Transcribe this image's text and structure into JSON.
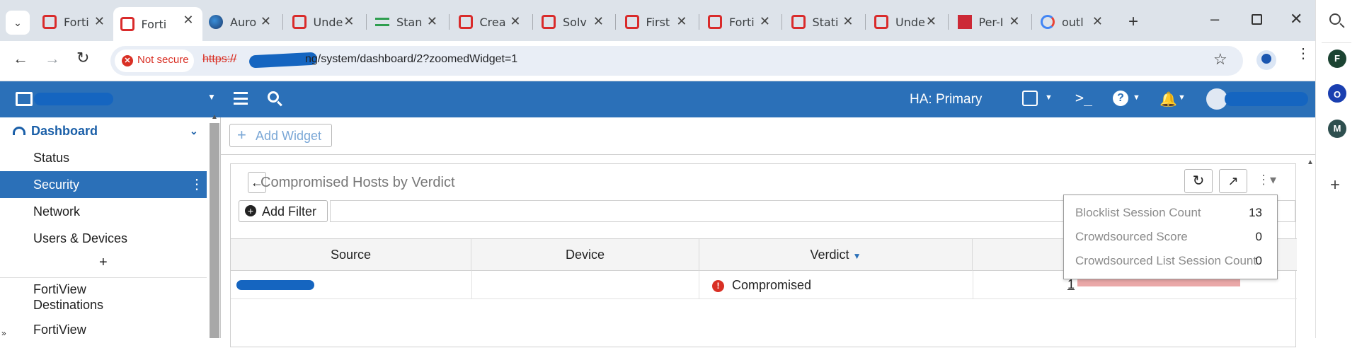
{
  "browser": {
    "tabs": [
      {
        "title": "Forti",
        "icon": "fortinet-icon"
      },
      {
        "title": "Forti",
        "icon": "fortinet-icon",
        "active": true
      },
      {
        "title": "Auro",
        "icon": "globe-icon"
      },
      {
        "title": "Unde",
        "icon": "fortinet-icon"
      },
      {
        "title": "Stan",
        "icon": "green-link-icon"
      },
      {
        "title": "Crea",
        "icon": "fortinet-icon"
      },
      {
        "title": "Solv",
        "icon": "fortinet-icon"
      },
      {
        "title": "First",
        "icon": "fortinet-icon"
      },
      {
        "title": "Forti",
        "icon": "fortinet-icon"
      },
      {
        "title": "Stati",
        "icon": "fortinet-icon"
      },
      {
        "title": "Unde",
        "icon": "fortinet-icon"
      },
      {
        "title": "Per-I",
        "icon": "zotero-icon"
      },
      {
        "title": "outl",
        "icon": "google-icon"
      }
    ],
    "not_secure_label": "Not secure",
    "url_scheme": "https://",
    "url_path": "ng/system/dashboard/2?zoomedWidget=1",
    "side_avatars": [
      "F",
      "O",
      "M"
    ]
  },
  "fg_header": {
    "ha_status": "HA: Primary"
  },
  "nav": {
    "section": "Dashboard",
    "items": [
      "Status",
      "Security",
      "Network",
      "Users & Devices"
    ],
    "add_symbol": "+",
    "fortiview_destinations": "FortiView Destinations",
    "fortiview_more": "FortiView"
  },
  "main": {
    "add_widget": "Add Widget",
    "widget_title": "Compromised Hosts by Verdict",
    "add_filter": "Add Filter",
    "columns": [
      "Source",
      "Device",
      "Verdict",
      ""
    ],
    "rows": [
      {
        "source": "",
        "device": "",
        "verdict": "Compromised",
        "count": "1"
      }
    ]
  },
  "tooltip": {
    "rows": [
      {
        "label": "Blocklist Session Count",
        "value": "13"
      },
      {
        "label": "Crowdsourced Score",
        "value": "0"
      },
      {
        "label": "Crowdsourced List Session Count",
        "value": "0"
      }
    ]
  },
  "colors": {
    "fg_blue": "#2b70b8",
    "tabstrip": "#dde3ea",
    "compromised_red": "#d93025",
    "bar_pink": "#eaa8a8"
  }
}
